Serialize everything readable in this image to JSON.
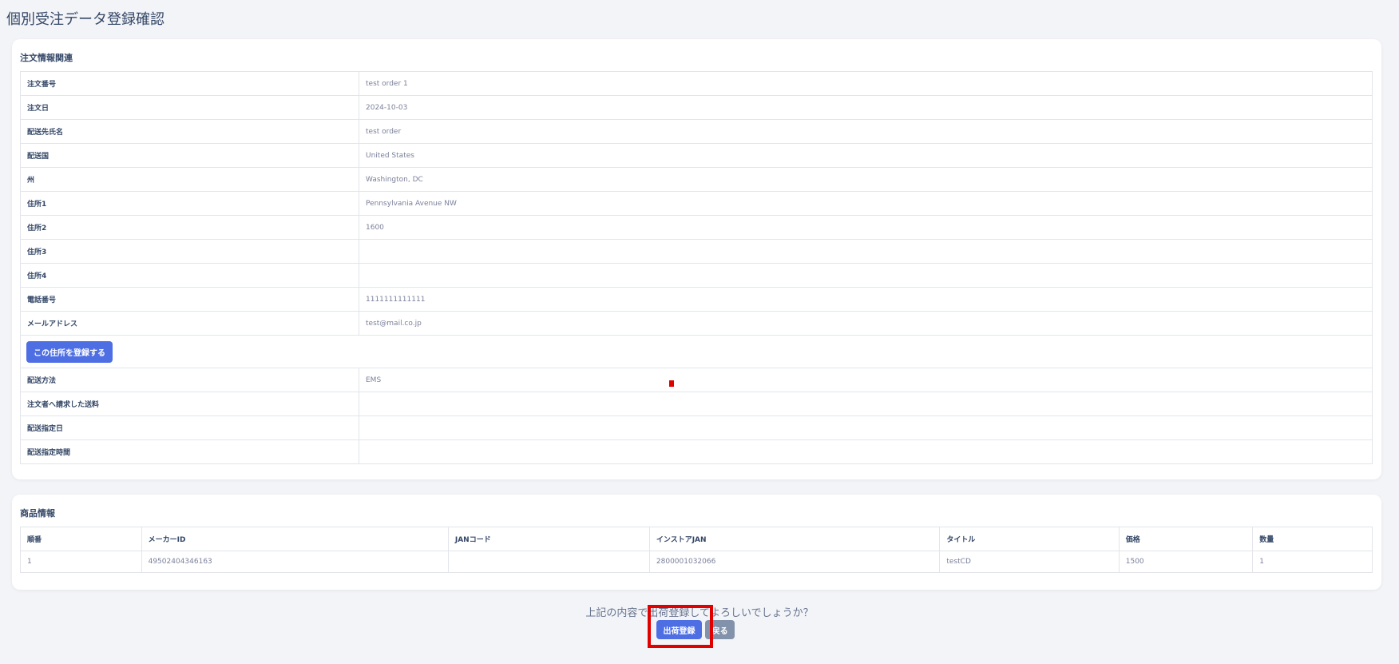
{
  "page": {
    "title": "個別受注データ登録確認"
  },
  "order_section": {
    "title": "注文情報関連",
    "rows_top": [
      {
        "label": "注文番号",
        "value": "test order 1"
      },
      {
        "label": "注文日",
        "value": "2024-10-03"
      },
      {
        "label": "配送先氏名",
        "value": "test order"
      },
      {
        "label": "配送国",
        "value": "United States"
      },
      {
        "label": "州",
        "value": "Washington, DC"
      },
      {
        "label": "住所1",
        "value": "Pennsylvania Avenue NW"
      },
      {
        "label": "住所2",
        "value": "1600"
      },
      {
        "label": "住所3",
        "value": ""
      },
      {
        "label": "住所4",
        "value": ""
      },
      {
        "label": "電話番号",
        "value": "1111111111111"
      },
      {
        "label": "メールアドレス",
        "value": "test@mail.co.jp"
      }
    ],
    "register_address_button": "この住所を登録する",
    "rows_bottom": [
      {
        "label": "配送方法",
        "value": "EMS"
      },
      {
        "label": "注文者へ請求した送料",
        "value": ""
      },
      {
        "label": "配送指定日",
        "value": ""
      },
      {
        "label": "配送指定時間",
        "value": ""
      }
    ]
  },
  "product_section": {
    "title": "商品情報",
    "columns": [
      "順番",
      "メーカーID",
      "JANコード",
      "インストアJAN",
      "タイトル",
      "価格",
      "数量"
    ],
    "rows": [
      [
        "1",
        "49502404346163",
        "",
        "2800001032066",
        "testCD",
        "1500",
        "1"
      ]
    ]
  },
  "confirm": {
    "message": "上記の内容で出荷登録してよろしいでしょうか？",
    "submit_button": "出荷登録",
    "back_button": "戻る"
  },
  "colors": {
    "primary": "#4e6ee4",
    "secondary": "#8392ab",
    "highlight": "#e00000"
  }
}
